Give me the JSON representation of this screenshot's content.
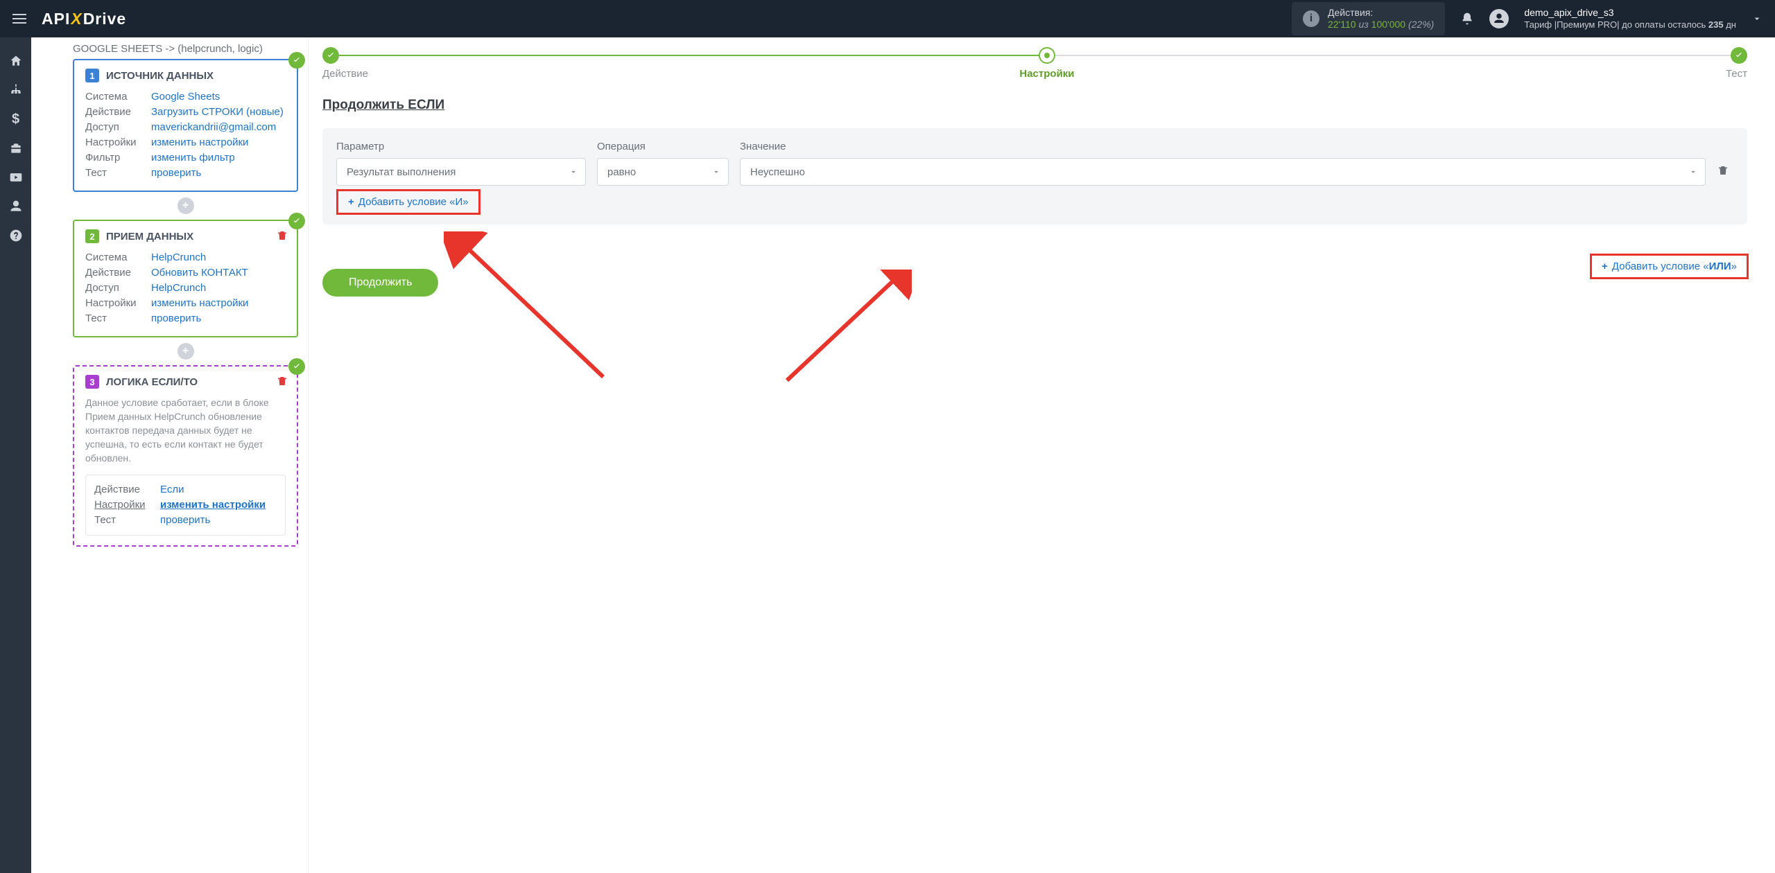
{
  "header": {
    "logo_a": "API",
    "logo_b": "Drive",
    "actions_label": "Действия:",
    "actions_used": "22'110",
    "actions_of": "из",
    "actions_limit": "100'000",
    "actions_pct": "(22%)",
    "user_name": "demo_apix_drive_s3",
    "tariff_line": "Тариф |Премиум PRO|  до оплаты осталось ",
    "tariff_days": "235",
    "tariff_suffix": " дн"
  },
  "breadcrumb": "GOOGLE SHEETS -> (helpcrunch, logic)",
  "card1": {
    "title": "ИСТОЧНИК ДАННЫХ",
    "system_k": "Система",
    "system_v": "Google Sheets",
    "action_k": "Действие",
    "action_v": "Загрузить СТРОКИ (новые)",
    "access_k": "Доступ",
    "access_v": "maverickandrii@gmail.com",
    "settings_k": "Настройки",
    "settings_v": "изменить настройки",
    "filter_k": "Фильтр",
    "filter_v": "изменить фильтр",
    "test_k": "Тест",
    "test_v": "проверить"
  },
  "card2": {
    "title": "ПРИЕМ ДАННЫХ",
    "system_k": "Система",
    "system_v": "HelpCrunch",
    "action_k": "Действие",
    "action_v": "Обновить КОНТАКТ",
    "access_k": "Доступ",
    "access_v": "HelpCrunch",
    "settings_k": "Настройки",
    "settings_v": "изменить настройки",
    "test_k": "Тест",
    "test_v": "проверить"
  },
  "card3": {
    "title": "ЛОГИКА ЕСЛИ/ТО",
    "desc": "Данное условие сработает, если в блоке Прием данных HelpCrunch обновление контактов передача данных будет не успешна, то есть если контакт не будет обновлен.",
    "action_k": "Действие",
    "action_v": "Если",
    "settings_k": "Настройки",
    "settings_v": "изменить настройки",
    "test_k": "Тест",
    "test_v": "проверить"
  },
  "stepper": {
    "s1": "Действие",
    "s2": "Настройки",
    "s3": "Тест"
  },
  "section_title": "Продолжить ЕСЛИ",
  "cond": {
    "head_param": "Параметр",
    "head_op": "Операция",
    "head_val": "Значение",
    "param": "Результат выполнения",
    "op": "равно",
    "val": "Неуспешно",
    "add_and": "Добавить условие «И»",
    "add_or_prefix": "Добавить условие «",
    "add_or_bold": "ИЛИ",
    "add_or_suffix": "»"
  },
  "continue_btn": "Продолжить"
}
